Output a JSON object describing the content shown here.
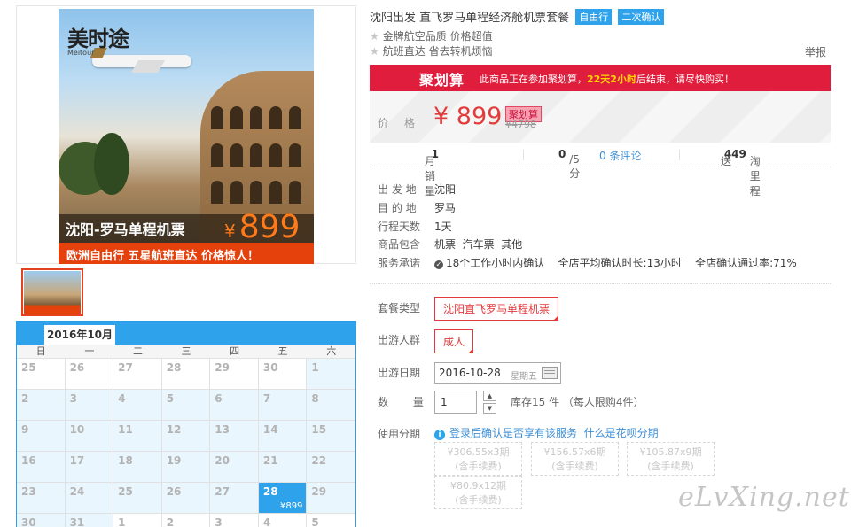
{
  "gallery": {
    "brand": "美时途",
    "brand_sub": "Meitour",
    "route_text": "沈阳-罗马单程机票",
    "price_symbol": "¥",
    "price_value": "899",
    "strip_text": "欧洲自由行 五星航班直达 价格惊人！"
  },
  "calendar": {
    "month": "2016年10月",
    "weekdays": [
      "日",
      "一",
      "二",
      "三",
      "四",
      "五",
      "六"
    ],
    "cells": [
      {
        "d": "25",
        "other": true
      },
      {
        "d": "26",
        "other": true
      },
      {
        "d": "27",
        "other": true
      },
      {
        "d": "28",
        "other": true
      },
      {
        "d": "29",
        "other": true
      },
      {
        "d": "30",
        "other": true
      },
      {
        "d": "1",
        "other": false
      },
      {
        "d": "2",
        "other": false
      },
      {
        "d": "3",
        "other": false
      },
      {
        "d": "4",
        "other": false
      },
      {
        "d": "5",
        "other": false
      },
      {
        "d": "6",
        "other": false
      },
      {
        "d": "7",
        "other": false
      },
      {
        "d": "8",
        "other": false
      },
      {
        "d": "9",
        "other": false
      },
      {
        "d": "10",
        "other": false
      },
      {
        "d": "11",
        "other": false
      },
      {
        "d": "12",
        "other": false
      },
      {
        "d": "13",
        "other": false
      },
      {
        "d": "14",
        "other": false
      },
      {
        "d": "15",
        "other": false
      },
      {
        "d": "16",
        "other": false
      },
      {
        "d": "17",
        "other": false
      },
      {
        "d": "18",
        "other": false
      },
      {
        "d": "19",
        "other": false
      },
      {
        "d": "20",
        "other": false
      },
      {
        "d": "21",
        "other": false
      },
      {
        "d": "22",
        "other": false
      },
      {
        "d": "23",
        "other": false
      },
      {
        "d": "24",
        "other": false
      },
      {
        "d": "25",
        "other": false
      },
      {
        "d": "26",
        "other": false
      },
      {
        "d": "27",
        "other": false
      },
      {
        "d": "28",
        "other": false,
        "selected": true,
        "price": "¥899"
      },
      {
        "d": "29",
        "other": false
      },
      {
        "d": "30",
        "other": false
      },
      {
        "d": "31",
        "other": false
      },
      {
        "d": "1",
        "other": true
      },
      {
        "d": "2",
        "other": true
      },
      {
        "d": "3",
        "other": true
      },
      {
        "d": "4",
        "other": true
      },
      {
        "d": "5",
        "other": true
      }
    ]
  },
  "product": {
    "title": "沈阳出发 直飞罗马单程经济舱机票套餐",
    "tags": [
      "自由行",
      "二次确认"
    ],
    "features": [
      "金牌航空品质 价格超值",
      "航班直达 省去转机烦恼"
    ],
    "report": "举报"
  },
  "juhuasuan": {
    "logo": "聚划算",
    "msg_pre": "此商品正在参加聚划算，",
    "msg_time": "22天2小时",
    "msg_post": "后结束，请尽快购买！"
  },
  "price": {
    "label": "价格",
    "now": "¥ 899",
    "badge": "聚划算",
    "old": "¥4798"
  },
  "stats": {
    "sales_label": "月销量",
    "sales_value": "1",
    "rating_value": "0",
    "rating_unit": "/5分",
    "reviews": "0 条评论",
    "points_pre": "送",
    "points_value": "449",
    "points_post": "淘里程"
  },
  "info": [
    {
      "k": "出 发 地",
      "v": "沈阳"
    },
    {
      "k": "目 的 地",
      "v": "罗马"
    },
    {
      "k": "行程天数",
      "v": "1天"
    },
    {
      "k": "商品包含",
      "v": "机票  汽车票  其他"
    },
    {
      "k": "服务承诺",
      "v": "18个工作小时内确认    全店平均确认时长:13小时    全店确认通过率:71%"
    }
  ],
  "options": {
    "package_label": "套餐类型",
    "package_value": "沈阳直飞罗马单程机票",
    "group_label": "出游人群",
    "group_value": "成人",
    "date_label": "出游日期",
    "date_value": "2016-10-28",
    "date_week": "星期五",
    "qty_label": "数 量",
    "qty_value": "1",
    "stock": "库存15 件  （每人限购4件）",
    "install_label": "使用分期",
    "install_login": "登录后确认是否享有该服务",
    "install_what": "什么是花呗分期",
    "installments": [
      {
        "amount": "¥306.55x3期",
        "fee": "(含手续费)"
      },
      {
        "amount": "¥156.57x6期",
        "fee": "(含手续费)"
      },
      {
        "amount": "¥105.87x9期",
        "fee": "(含手续费)"
      },
      {
        "amount": "¥80.9x12期",
        "fee": "(含手续费)"
      }
    ]
  },
  "watermark": "eLvXing.net"
}
